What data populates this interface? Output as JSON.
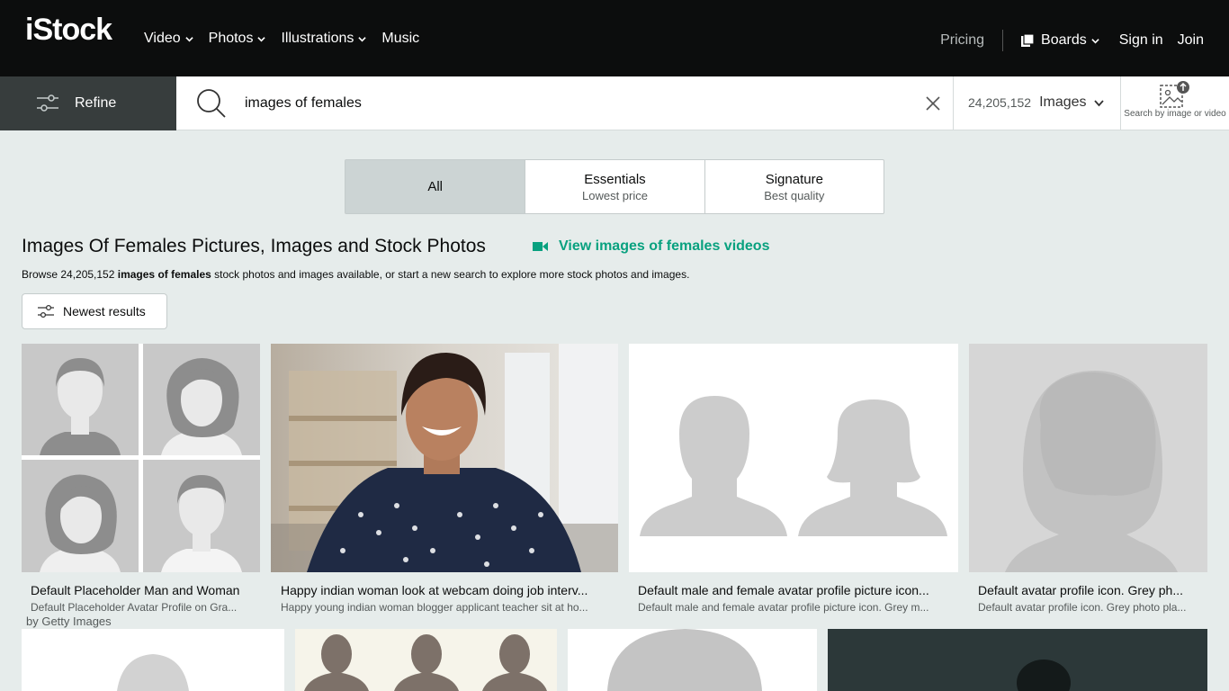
{
  "brand": {
    "logo_main": "iStock",
    "logo_sub": "by Getty Images"
  },
  "nav": {
    "items": [
      {
        "label": "Video",
        "has_dropdown": true
      },
      {
        "label": "Photos",
        "has_dropdown": true
      },
      {
        "label": "Illustrations",
        "has_dropdown": true
      },
      {
        "label": "Music",
        "has_dropdown": false
      }
    ],
    "pricing": "Pricing",
    "boards": "Boards",
    "sign_in": "Sign in",
    "join": "Join"
  },
  "searchbar": {
    "refine": "Refine",
    "query": "images of females",
    "count": "24,205,152",
    "media_type": "Images",
    "search_by_image": "Search by image or video"
  },
  "tabs": [
    {
      "title": "All",
      "subtitle": ""
    },
    {
      "title": "Essentials",
      "subtitle": "Lowest price"
    },
    {
      "title": "Signature",
      "subtitle": "Best quality"
    }
  ],
  "heading": {
    "title": "Images Of Females Pictures, Images and Stock Photos",
    "video_link": "View images of females videos",
    "browse_prefix": "Browse 24,205,152 ",
    "browse_bold": "images of females",
    "browse_suffix": " stock photos and images available, or start a new search to explore more stock photos and images."
  },
  "sort": {
    "label": "Newest results"
  },
  "results": [
    {
      "title": "Default Placeholder Man and Woman",
      "subtitle": "Default Placeholder Avatar Profile on Gra..."
    },
    {
      "title": "Happy indian woman look at webcam doing job interv...",
      "subtitle": "Happy young indian woman blogger applicant teacher sit at ho..."
    },
    {
      "title": "Default male and female avatar profile picture icon...",
      "subtitle": "Default male and female avatar profile picture icon. Grey m..."
    },
    {
      "title": "Default avatar profile icon. Grey ph...",
      "subtitle": "Default avatar profile icon. Grey photo pla..."
    }
  ],
  "colors": {
    "nav_bg": "#0c0d0d",
    "accent": "#08a17f",
    "page_bg": "#e6eceb",
    "refine_bg": "#373d3d"
  }
}
